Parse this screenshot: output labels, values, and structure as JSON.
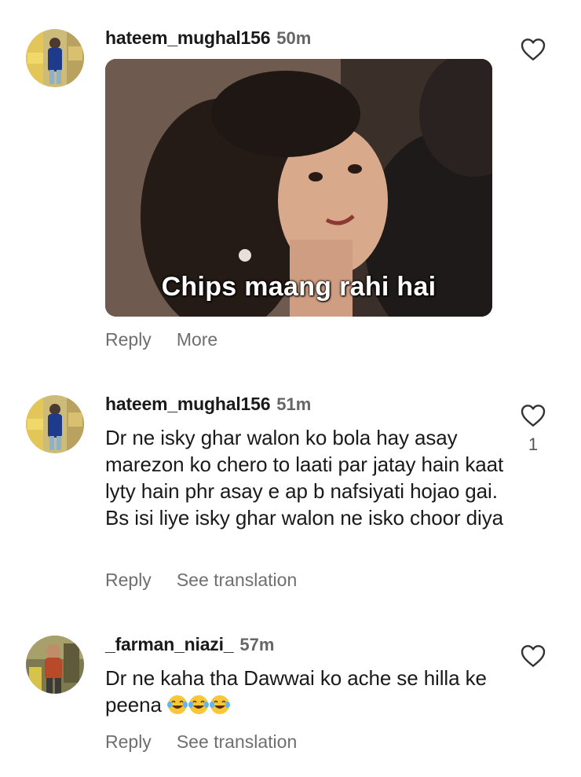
{
  "comments": [
    {
      "username": "hateem_mughal156",
      "time": "50m",
      "gif_caption": "Chips maang rahi hai",
      "actions": [
        "Reply",
        "More"
      ]
    },
    {
      "username": "hateem_mughal156",
      "time": "51m",
      "text": "Dr ne isky ghar walon ko bola hay asay marezon ko chero to laati par jatay hain kaat lyty hain phr asay e ap b nafsiyati hojao gai. Bs isi liye isky ghar walon ne isko choor diya",
      "likes": "1",
      "actions": [
        "Reply",
        "See translation"
      ]
    },
    {
      "username": "_farman_niazi_",
      "time": "57m",
      "text": "Dr ne kaha tha Dawwai ko ache se hilla ke peena",
      "emoji": [
        "face-with-tears-of-joy",
        "face-with-tears-of-joy",
        "face-with-tears-of-joy"
      ],
      "actions": [
        "Reply",
        "See translation"
      ]
    }
  ],
  "icons": {
    "like": "heart-outline-icon",
    "reaction": "face-with-tears-of-joy-emoji"
  },
  "colors": {
    "text": "#1a1a1a",
    "secondary": "#6f6f6f",
    "background": "#ffffff"
  }
}
